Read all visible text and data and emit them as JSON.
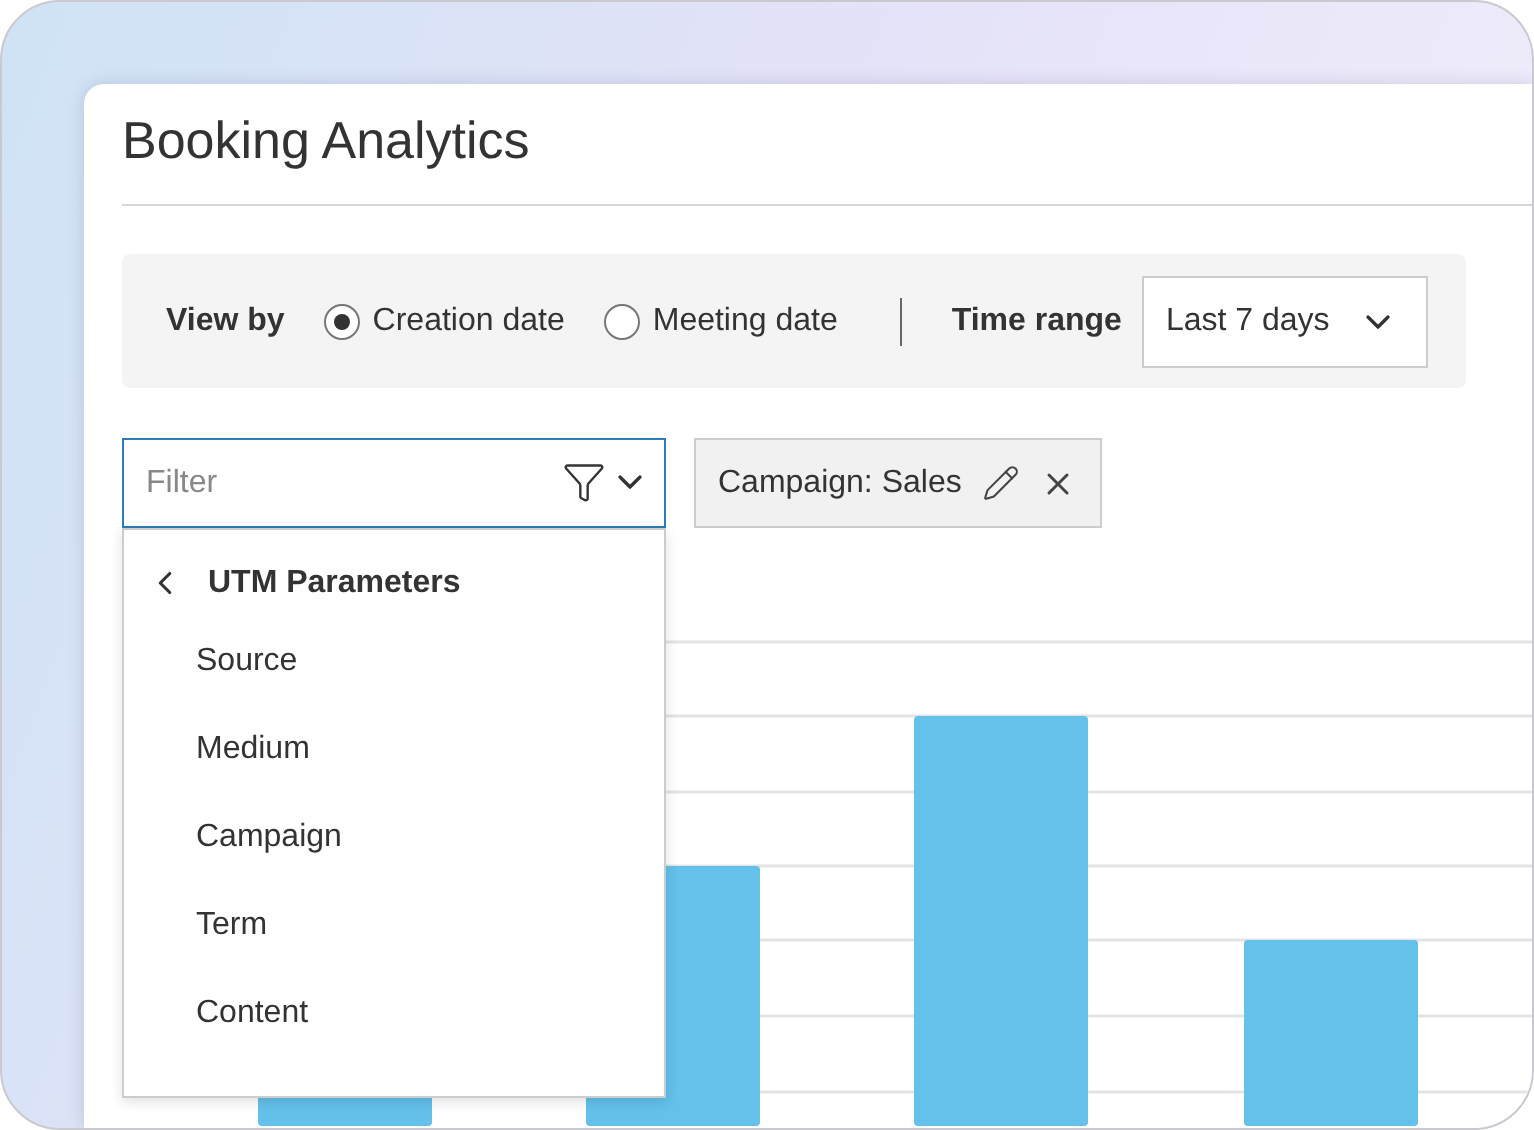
{
  "title": "Booking Analytics",
  "view_by": {
    "label": "View by",
    "options": [
      {
        "label": "Creation date",
        "selected": true
      },
      {
        "label": "Meeting date",
        "selected": false
      }
    ]
  },
  "time_range": {
    "label": "Time range",
    "value": "Last 7 days"
  },
  "filter": {
    "placeholder": "Filter",
    "menu": {
      "title": "UTM Parameters",
      "items": [
        "Source",
        "Medium",
        "Campaign",
        "Term",
        "Content"
      ]
    }
  },
  "chips": [
    {
      "label": "Campaign: Sales"
    }
  ]
}
